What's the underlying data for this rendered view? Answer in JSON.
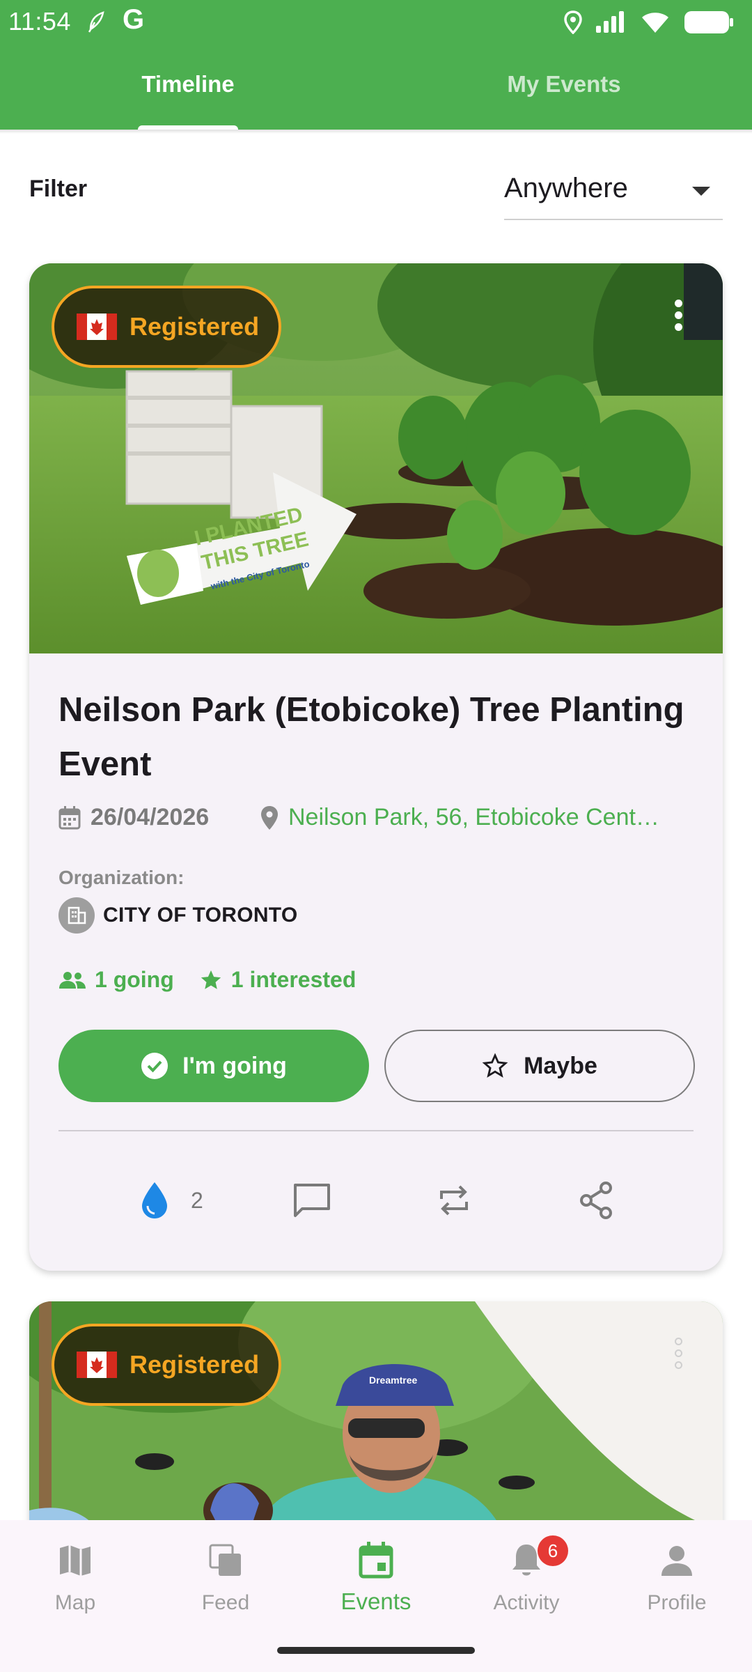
{
  "status_bar": {
    "time": "11:54",
    "g_logo": "G",
    "icons": [
      "location-icon",
      "signal-icon",
      "wifi-icon",
      "battery-icon"
    ]
  },
  "tabs": [
    {
      "label": "Timeline",
      "active": true
    },
    {
      "label": "My Events",
      "active": false
    }
  ],
  "filter": {
    "label": "Filter",
    "value": "Anywhere"
  },
  "events": [
    {
      "badge": "Registered",
      "title": "Neilson Park (Etobicoke) Tree Planting Event",
      "date": "26/04/2026",
      "location": "Neilson Park, 56, Etobicoke Cent…",
      "organization_label": "Organization:",
      "organization": "CITY OF TORONTO",
      "going": "1 going",
      "interested": "1 interested",
      "btn_going": "I'm going",
      "btn_maybe": "Maybe",
      "drops": "2",
      "photo_sign_text": [
        "I PLANTED",
        "THIS TREE",
        "with the City of Toronto"
      ]
    },
    {
      "badge": "Registered",
      "photo_cap_text": "Dreamtree"
    }
  ],
  "bottom_nav": [
    {
      "label": "Map",
      "icon": "map-icon"
    },
    {
      "label": "Feed",
      "icon": "feed-icon"
    },
    {
      "label": "Events",
      "icon": "calendar-icon",
      "active": true
    },
    {
      "label": "Activity",
      "icon": "bell-icon",
      "badge": "6"
    },
    {
      "label": "Profile",
      "icon": "person-icon"
    }
  ],
  "colors": {
    "primary": "#4caf50",
    "badge_border": "#f5a623",
    "notif": "#e53935",
    "drop": "#1e88e5"
  }
}
